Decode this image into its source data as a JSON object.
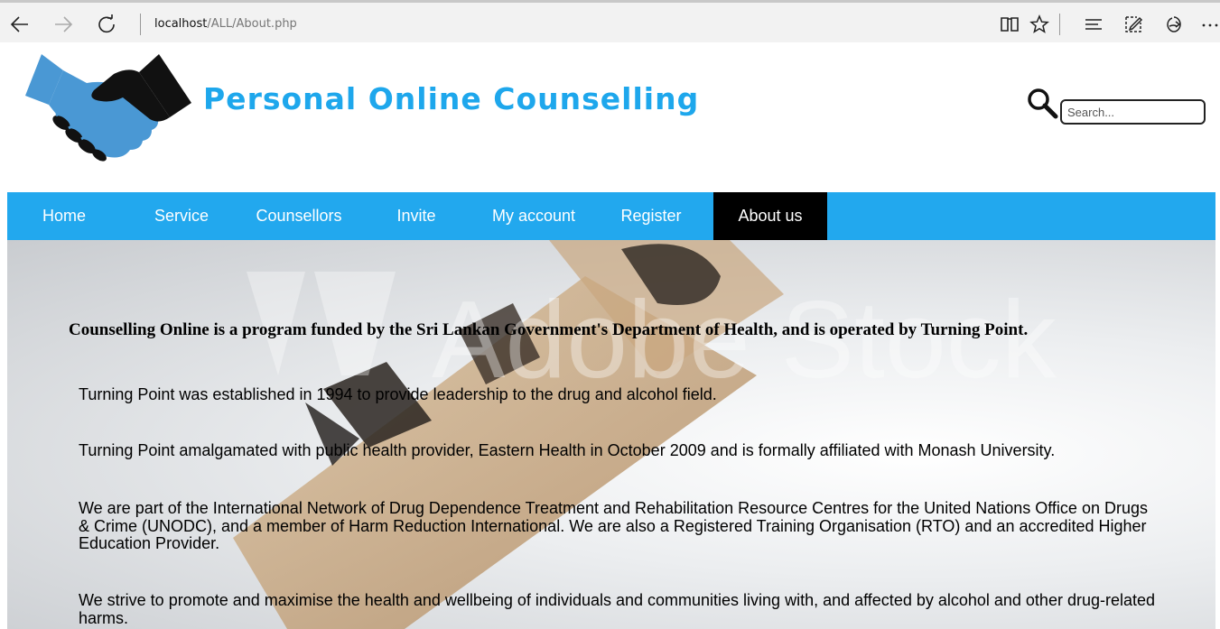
{
  "browser": {
    "url_host": "localhost",
    "url_path": "/ALL/About.php"
  },
  "site": {
    "title": "Personal Online Counselling",
    "search_placeholder": "Search...",
    "brand_color": "#1ea7ec",
    "nav_color": "#22a8ee"
  },
  "nav": {
    "items": [
      {
        "label": "Home"
      },
      {
        "label": "Service"
      },
      {
        "label": "Counsellors"
      },
      {
        "label": "Invite"
      },
      {
        "label": "My account"
      },
      {
        "label": "Register"
      },
      {
        "label": "About us",
        "active": true
      }
    ]
  },
  "content": {
    "lead": "Counselling Online is a program funded by the Sri Lankan Government's Department of Health, and is operated by Turning Point.",
    "paragraphs": [
      "Turning Point was established in 1994 to provide leadership to the drug and alcohol field.",
      "Turning Point amalgamated with public health provider, Eastern Health in October 2009 and is formally affiliated with Monash University.",
      "We are part of the International Network of Drug Dependence Treatment and Rehabilitation Resource Centres for the United Nations Office on Drugs & Crime (UNODC), and a member of Harm Reduction International. We are also a Registered Training Organisation (RTO) and an accredited Higher Education Provider.",
      "We strive to promote and maximise the health and wellbeing of individuals and communities living with, and affected by alcohol and other drug-related harms."
    ]
  },
  "background": {
    "watermark": "Adobe Stock"
  }
}
